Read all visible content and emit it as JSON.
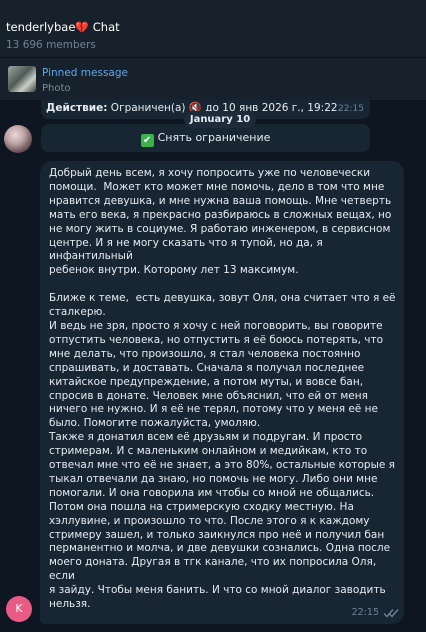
{
  "header": {
    "title": "tenderlybae",
    "title_suffix": " Chat",
    "heart_emoji": "💔",
    "members": "13 696 members"
  },
  "pinned": {
    "title": "Pinned message",
    "subtitle": "Photo"
  },
  "service_message": {
    "action_label": "Действие:",
    "action_text": " Ограничен(а) 🔇 до 10 янв 2026 г., 19:22.",
    "time": "22:15"
  },
  "date_separator": "January 10",
  "unban_button": {
    "icon": "✔",
    "label": "Снять ограничение"
  },
  "message": {
    "text": "Добрый день всем, я хочу попросить уже по человечески\nпомощи.  Может кто может мне помочь, дело в том что мне\nнравится девушка, и мне нужна ваша помощь. Мне четверть\nмать его века, я прекрасно разбираюсь в сложных вещах, но\nне могу жить в социуме. Я работаю инженером, в сервисном\nцентре. И я не могу сказать что я тупой, но да, я инфантильный\nребенок внутри. Которому лет 13 максимум.\n\nБлиже к теме,  есть девушка, зовут Оля, она считает что я её\nсталкерю.\nИ ведь не зря, просто я хочу с ней поговорить, вы говорите\nотпустить человека, но отпустить я её боюсь потерять, что\nмне делать, что произошло, я стал человека постоянно\nспрашивать, и доставать. Сначала я получал последнее\nкитайское предупреждение, а потом муты, и вовсе бан,\nспросив в донате. Человек мне объяснил, что ей от меня\nничего не нужно. И я её не терял, потому что у меня её не\nбыло. Помогите пожалуйста, умоляю.\nТакже я донатил всем её друзьям и подругам. И просто\nстримерам. И с маленьким онлайном и медийкам, кто то\nотвечал мне что её не знает, а это 80%, остальные которые я\nтыкал отвечали да знаю, но помочь не могу. Либо они мне\nпомогали. И она говорила им чтобы со мной не общались.\nПотом она пошла на стримерскую сходку местную. На\nхэллувине, и произошло то что. После этого я к каждому\nстримеру зашел, и только заикнулся про неё и получил бан\nперманентно и молча, и две девушки сознались. Одна после\nмоего доната. Другая в тгк канале, что их попросила Оля, если\nя зайду. Чтобы меня банить. И что со мной диалог заводить\nнельзя.",
    "time": "22:15"
  },
  "sender_avatar_letter": "K",
  "colors": {
    "background": "#0e1621",
    "header": "#17212b",
    "bubble": "#182533",
    "link": "#5fa8e8",
    "avatar_k": "#e95a85",
    "check": "#3bb24a"
  }
}
